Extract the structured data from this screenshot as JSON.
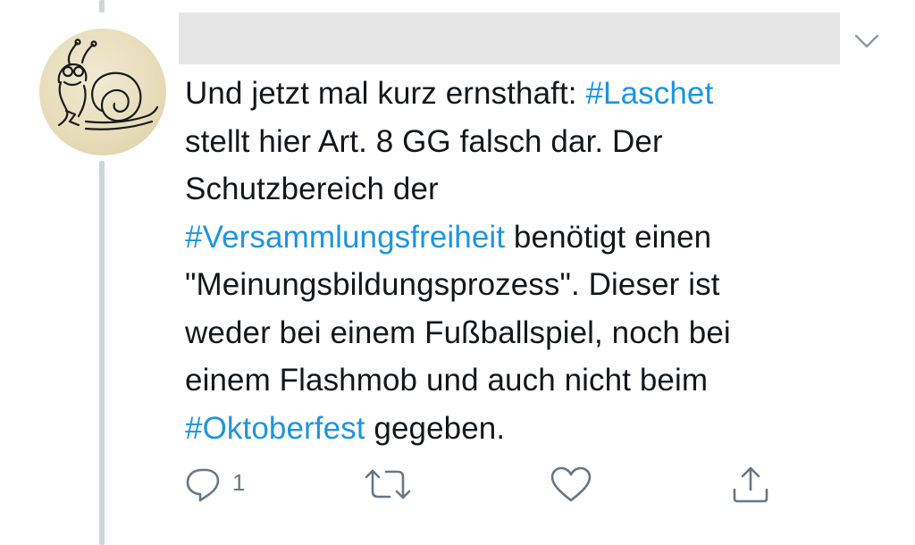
{
  "tweet": {
    "text_lines": [
      [
        {
          "t": "Und jetzt mal kurz ernsthaft: ",
          "tag": false
        },
        {
          "t": "#Laschet",
          "tag": true
        }
      ],
      [
        {
          "t": "stellt hier Art. 8 GG falsch dar. Der",
          "tag": false
        }
      ],
      [
        {
          "t": "Schutzbereich der",
          "tag": false
        }
      ],
      [
        {
          "t": "#Versammlungsfreiheit",
          "tag": true
        },
        {
          "t": " benötigt einen",
          "tag": false
        }
      ],
      [
        {
          "t": "\"Meinungsbildungsprozess\". Dieser ist",
          "tag": false
        }
      ],
      [
        {
          "t": "weder bei einem Fußballspiel, noch bei",
          "tag": false
        }
      ],
      [
        {
          "t": "einem Flashmob und auch nicht beim",
          "tag": false
        }
      ],
      [
        {
          "t": "#Oktoberfest",
          "tag": true
        },
        {
          "t": " gegeben.",
          "tag": false
        }
      ]
    ],
    "hashtag_color": "#1b95e0",
    "text_color": "#14171a"
  },
  "actions": {
    "reply_count": "1",
    "icon_color": "#657786",
    "reply_icon": "reply-icon",
    "retweet_icon": "retweet-icon",
    "like_icon": "heart-icon",
    "share_icon": "share-icon"
  },
  "menu": {
    "icon": "chevron-down-icon"
  }
}
